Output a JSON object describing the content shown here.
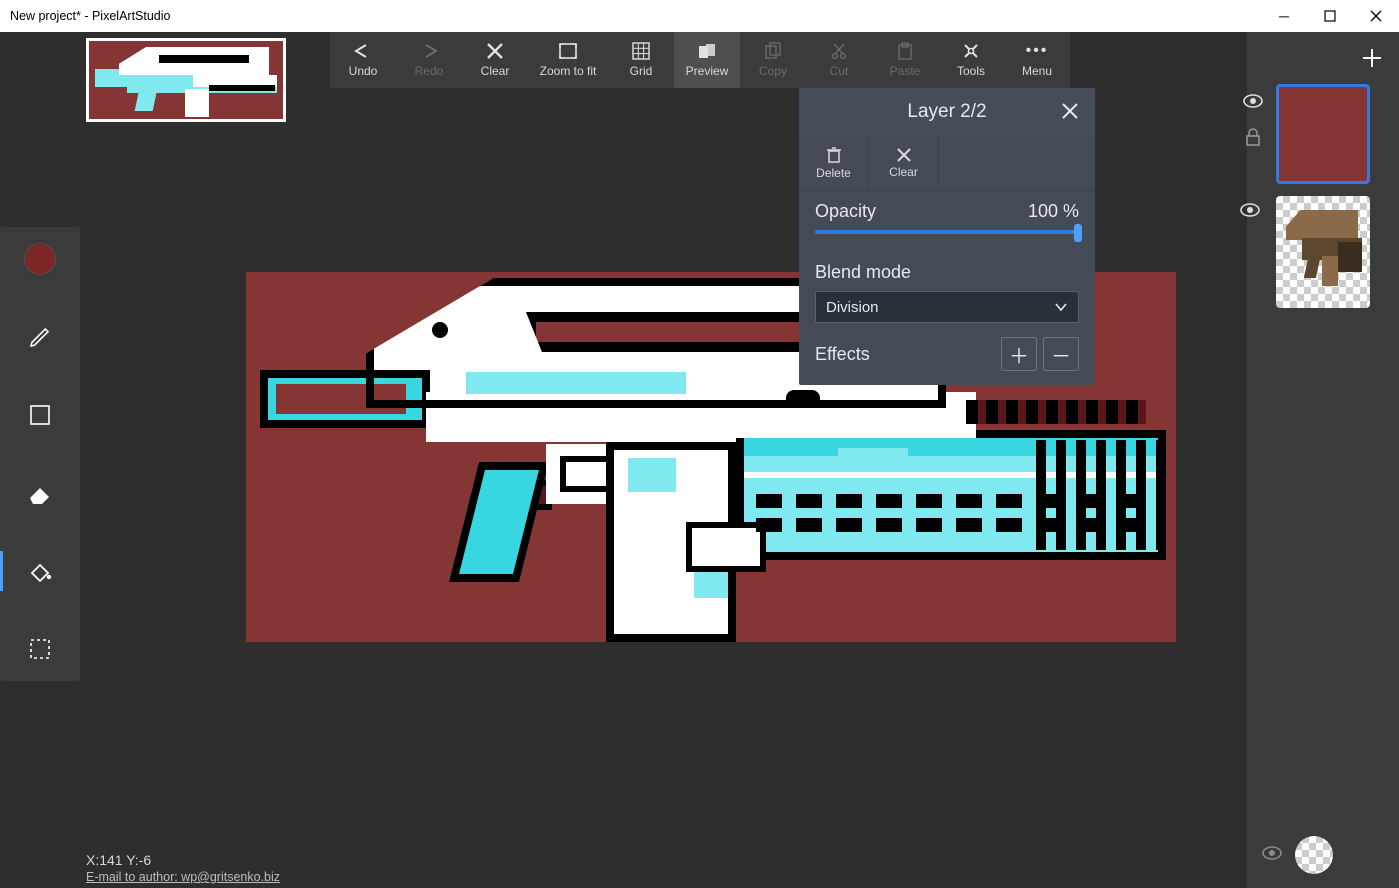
{
  "window": {
    "title": "New project* - PixelArtStudio",
    "min_label": "—",
    "max_label": "☐",
    "close_label": "✕"
  },
  "toolbar": {
    "undo": "Undo",
    "redo": "Redo",
    "clear": "Clear",
    "zoom_to_fit": "Zoom to fit",
    "grid": "Grid",
    "preview": "Preview",
    "copy": "Copy",
    "cut": "Cut",
    "paste": "Paste",
    "tools": "Tools",
    "menu": "Menu"
  },
  "left_tools": {
    "current_color": "#7c2626",
    "items": [
      "color",
      "pencil",
      "rectangle",
      "eraser",
      "fill",
      "marquee"
    ],
    "active": "fill"
  },
  "canvas": {
    "bg_color": "#863535",
    "sprite_colors": {
      "light": "#7fe9ef",
      "mid": "#37d6e0",
      "outline": "#000000",
      "body": "#ffffff"
    }
  },
  "layer_panel": {
    "title": "Layer 2/2",
    "delete": "Delete",
    "clear": "Clear",
    "opacity_label": "Opacity",
    "opacity_value": "100 %",
    "opacity_percent": 100,
    "blend_label": "Blend mode",
    "blend_value": "Division",
    "effects_label": "Effects"
  },
  "layers": {
    "add_label": "+",
    "items": [
      {
        "id": 2,
        "selected": true,
        "visible": true,
        "locked": true,
        "bg": "#863535"
      },
      {
        "id": 1,
        "selected": false,
        "visible": true,
        "locked": false,
        "bg": "checker"
      }
    ]
  },
  "status": {
    "coords": "X:141 Y:-6",
    "email": "E-mail to author: wp@gritsenko.biz"
  }
}
